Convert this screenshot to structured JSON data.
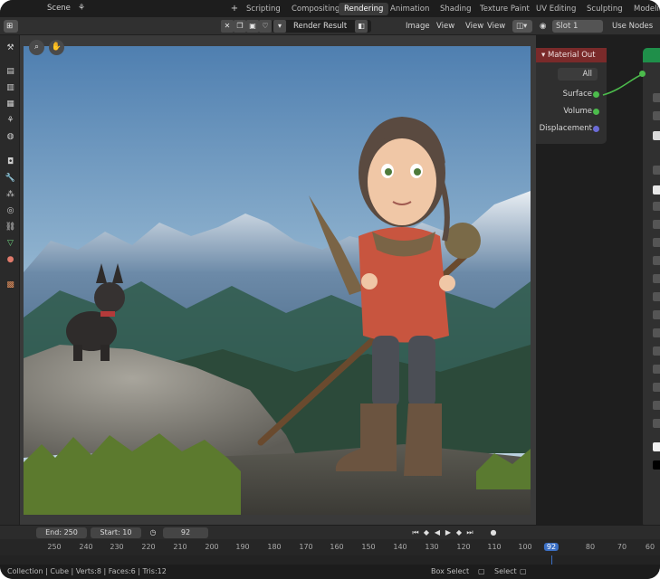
{
  "top_bar": {
    "scene": "Scene",
    "workspace_tabs": [
      "Modeling",
      "Sculpting",
      "UV Editing",
      "Texture Paint",
      "Shading",
      "Animation",
      "Rendering",
      "Compositing",
      "Scripting"
    ],
    "active_tab": "Rendering"
  },
  "image_editor": {
    "view_menu": "View",
    "image_menu": "Image",
    "image_name": "Render Result",
    "slot": "Slot 1",
    "view_menus": [
      "View",
      "View"
    ]
  },
  "node_editor": {
    "use_nodes": "Use Nodes",
    "node_title": "Material Out",
    "target": "All",
    "sockets": [
      "Surface",
      "Volume",
      "Displacement"
    ],
    "socket_colors": [
      "#4cbb4c",
      "#4cbb4c",
      "#6b6bd6"
    ]
  },
  "timeline": {
    "current_frame": "92",
    "start_label": "Start:",
    "start_value": "10",
    "end_label": "End:",
    "end_value": "250",
    "ticks": [
      "250",
      "240",
      "230",
      "220",
      "210",
      "200",
      "190",
      "180",
      "170",
      "160",
      "150",
      "140",
      "130",
      "120",
      "110",
      "100",
      "92",
      "80",
      "70",
      "60"
    ]
  },
  "status_bar": {
    "stats": "Collection | Cube | Verts:8 | Faces:6 | Tris:12",
    "box_select": "Box Select",
    "select": "Select"
  },
  "colors": {
    "accent": "#3b6fc4",
    "node_header": "#7a2a2a",
    "shader_node": "#1f8f4a"
  }
}
